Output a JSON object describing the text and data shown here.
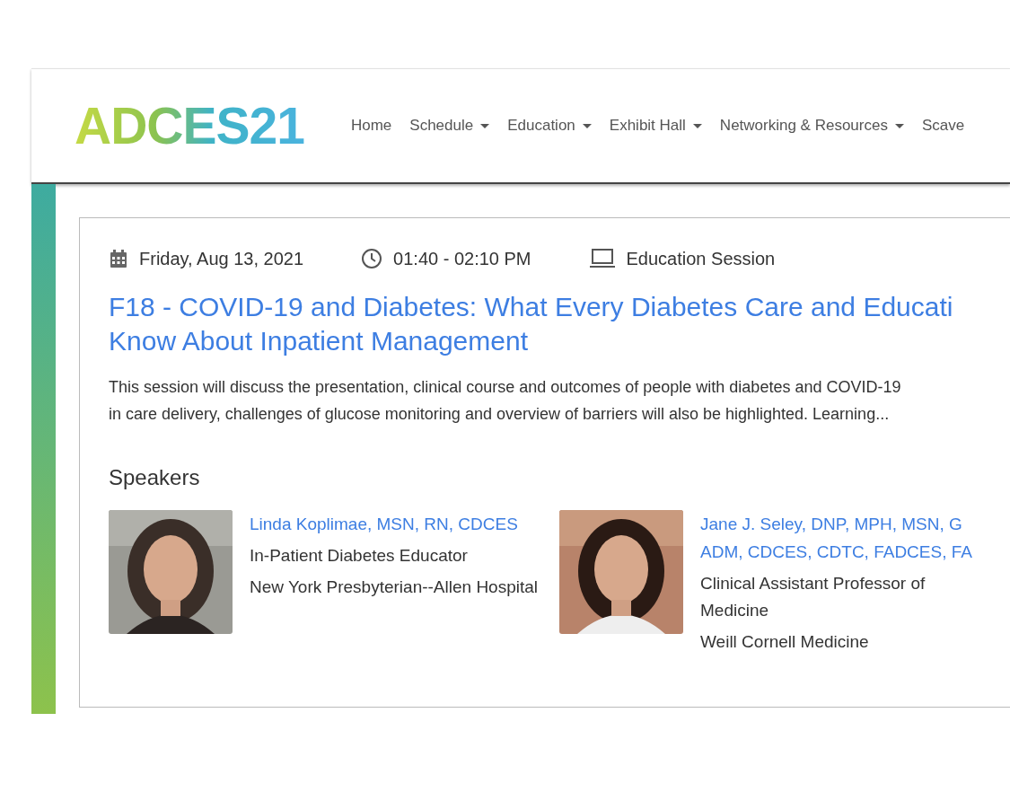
{
  "header": {
    "logo": "ADCES21",
    "nav": [
      {
        "label": "Home",
        "dropdown": false
      },
      {
        "label": "Schedule",
        "dropdown": true
      },
      {
        "label": "Education",
        "dropdown": true
      },
      {
        "label": "Exhibit Hall",
        "dropdown": true
      },
      {
        "label": "Networking & Resources",
        "dropdown": true
      },
      {
        "label": "Scave",
        "dropdown": false
      }
    ]
  },
  "session": {
    "meta": [
      {
        "kind": "date",
        "text": "Friday, Aug 13, 2021"
      },
      {
        "kind": "time",
        "text": "01:40 - 02:10 PM"
      },
      {
        "kind": "type",
        "text": "Education Session"
      }
    ],
    "title_lines": [
      "F18 - COVID-19 and Diabetes: What Every Diabetes Care and Educati",
      "Know About Inpatient Management"
    ],
    "description_lines": [
      "This session will discuss the presentation, clinical course and outcomes of people with diabetes and COVID-19",
      "in care delivery, challenges of glucose monitoring and overview of barriers will also be highlighted. Learning..."
    ],
    "speakers_heading": "Speakers",
    "speakers": [
      {
        "photo": {
          "kind": "picture"
        },
        "name_lines": [
          "Linda Koplimae, MSN, RN, CDCES"
        ],
        "role_lines": [
          "In-Patient Diabetes Educator"
        ],
        "organization": "New York Presbyterian--Allen Hospital"
      },
      {
        "photo": {
          "kind": "picture"
        },
        "name_lines": [
          "Jane J. Seley, DNP, MPH, MSN, G",
          "ADM, CDCES, CDTC, FADCES, FA"
        ],
        "role_lines": [
          "Clinical Assistant Professor of",
          "Medicine"
        ],
        "organization": "Weill Cornell Medicine"
      }
    ]
  }
}
